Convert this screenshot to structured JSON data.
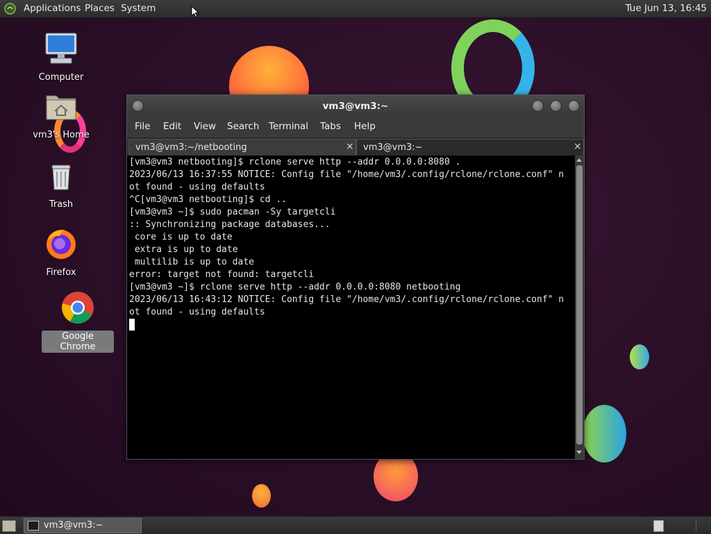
{
  "top_panel": {
    "menus": [
      "Applications",
      "Places",
      "System"
    ],
    "clock": "Tue Jun 13, 16:45"
  },
  "desktop_icons": [
    {
      "label": "Computer"
    },
    {
      "label": "vm3's Home"
    },
    {
      "label": "Trash"
    },
    {
      "label": "Firefox"
    },
    {
      "label": "Google Chrome"
    }
  ],
  "window": {
    "title": "vm3@vm3:~",
    "menu": [
      "File",
      "Edit",
      "View",
      "Search",
      "Terminal",
      "Tabs",
      "Help"
    ],
    "tabs": [
      {
        "label": "vm3@vm3:~/netbooting"
      },
      {
        "label": "vm3@vm3:~"
      }
    ],
    "close_glyph": "×",
    "terminal_lines": [
      "[vm3@vm3 netbooting]$ rclone serve http --addr 0.0.0.0:8080 .",
      "2023/06/13 16:37:55 NOTICE: Config file \"/home/vm3/.config/rclone/rclone.conf\" n",
      "ot found - using defaults",
      "^C[vm3@vm3 netbooting]$ cd ..",
      "[vm3@vm3 ~]$ sudo pacman -Sy targetcli",
      ":: Synchronizing package databases...",
      " core is up to date",
      " extra is up to date",
      " multilib is up to date",
      "error: target not found: targetcli",
      "[vm3@vm3 ~]$ rclone serve http --addr 0.0.0.0:8080 netbooting",
      "2023/06/13 16:43:12 NOTICE: Config file \"/home/vm3/.config/rclone/rclone.conf\" n",
      "ot found - using defaults"
    ]
  },
  "bottom_panel": {
    "task_label": "vm3@vm3:~"
  },
  "colors": {
    "desktop_bg": "#2a0f27",
    "terminal_bg": "#000000",
    "terminal_fg": "#e6e6e6"
  }
}
